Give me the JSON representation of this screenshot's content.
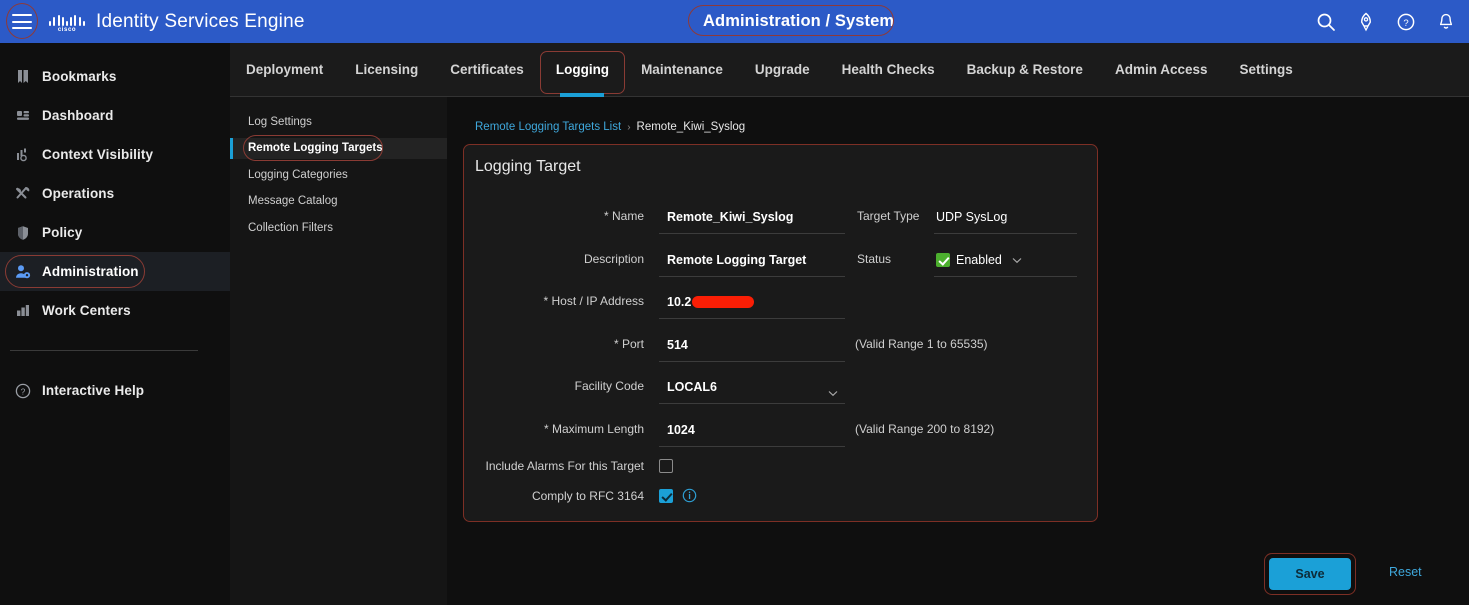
{
  "topbar": {
    "product_name": "Identity Services Engine",
    "brand": "cisco",
    "context_title": "Administration / System",
    "icons": [
      "search-icon",
      "rocket-icon",
      "help-circle-icon",
      "bell-icon"
    ]
  },
  "tabs": [
    {
      "label": "Deployment",
      "active": false
    },
    {
      "label": "Licensing",
      "active": false
    },
    {
      "label": "Certificates",
      "active": false
    },
    {
      "label": "Logging",
      "active": true
    },
    {
      "label": "Maintenance",
      "active": false
    },
    {
      "label": "Upgrade",
      "active": false
    },
    {
      "label": "Health Checks",
      "active": false
    },
    {
      "label": "Backup & Restore",
      "active": false
    },
    {
      "label": "Admin Access",
      "active": false
    },
    {
      "label": "Settings",
      "active": false
    }
  ],
  "sidebar": {
    "items": [
      {
        "label": "Bookmarks",
        "icon": "bookmark-icon",
        "selected": false
      },
      {
        "label": "Dashboard",
        "icon": "dashboard-icon",
        "selected": false
      },
      {
        "label": "Context Visibility",
        "icon": "context-visibility-icon",
        "selected": false
      },
      {
        "label": "Operations",
        "icon": "tools-icon",
        "selected": false
      },
      {
        "label": "Policy",
        "icon": "shield-icon",
        "selected": false
      },
      {
        "label": "Administration",
        "icon": "user-gear-icon",
        "selected": true
      },
      {
        "label": "Work Centers",
        "icon": "bar-chart-icon",
        "selected": false
      }
    ],
    "help": {
      "label": "Interactive Help",
      "icon": "question-circle-icon"
    }
  },
  "subnav": {
    "items": [
      {
        "label": "Log Settings",
        "selected": false
      },
      {
        "label": "Remote Logging Targets",
        "selected": true
      },
      {
        "label": "Logging Categories",
        "selected": false
      },
      {
        "label": "Message Catalog",
        "selected": false
      },
      {
        "label": "Collection Filters",
        "selected": false
      }
    ]
  },
  "breadcrumb": {
    "link": "Remote Logging Targets List",
    "separator": "›",
    "current": "Remote_Kiwi_Syslog"
  },
  "card": {
    "title": "Logging Target",
    "fields": {
      "name": {
        "label": "* Name",
        "value": "Remote_Kiwi_Syslog"
      },
      "target_type": {
        "label": "Target Type",
        "value": "UDP SysLog"
      },
      "description": {
        "label": "Description",
        "value": "Remote Logging Target"
      },
      "status": {
        "label": "Status",
        "value": "Enabled",
        "checked": true
      },
      "host_ip": {
        "label": "* Host / IP Address",
        "value": "10.2",
        "redacted": true
      },
      "port": {
        "label": "* Port",
        "value": "514",
        "hint": "(Valid Range 1 to 65535)"
      },
      "facility_code": {
        "label": "Facility Code",
        "value": "LOCAL6"
      },
      "max_length": {
        "label": "* Maximum Length",
        "value": "1024",
        "hint": "(Valid Range 200 to 8192)"
      },
      "include_alarms": {
        "label": "Include Alarms For this Target",
        "checked": false
      },
      "comply_rfc": {
        "label": "Comply to RFC 3164",
        "checked": true
      }
    }
  },
  "footer": {
    "save_label": "Save",
    "reset_label": "Reset"
  },
  "colors": {
    "brand_blue": "#2c5ac7",
    "accent_cyan": "#1ba0d7",
    "link_blue": "#3fa8dc",
    "status_green": "#4caf2e",
    "redaction_red": "#fa1e05",
    "annotation_red": "#8a3b34"
  }
}
